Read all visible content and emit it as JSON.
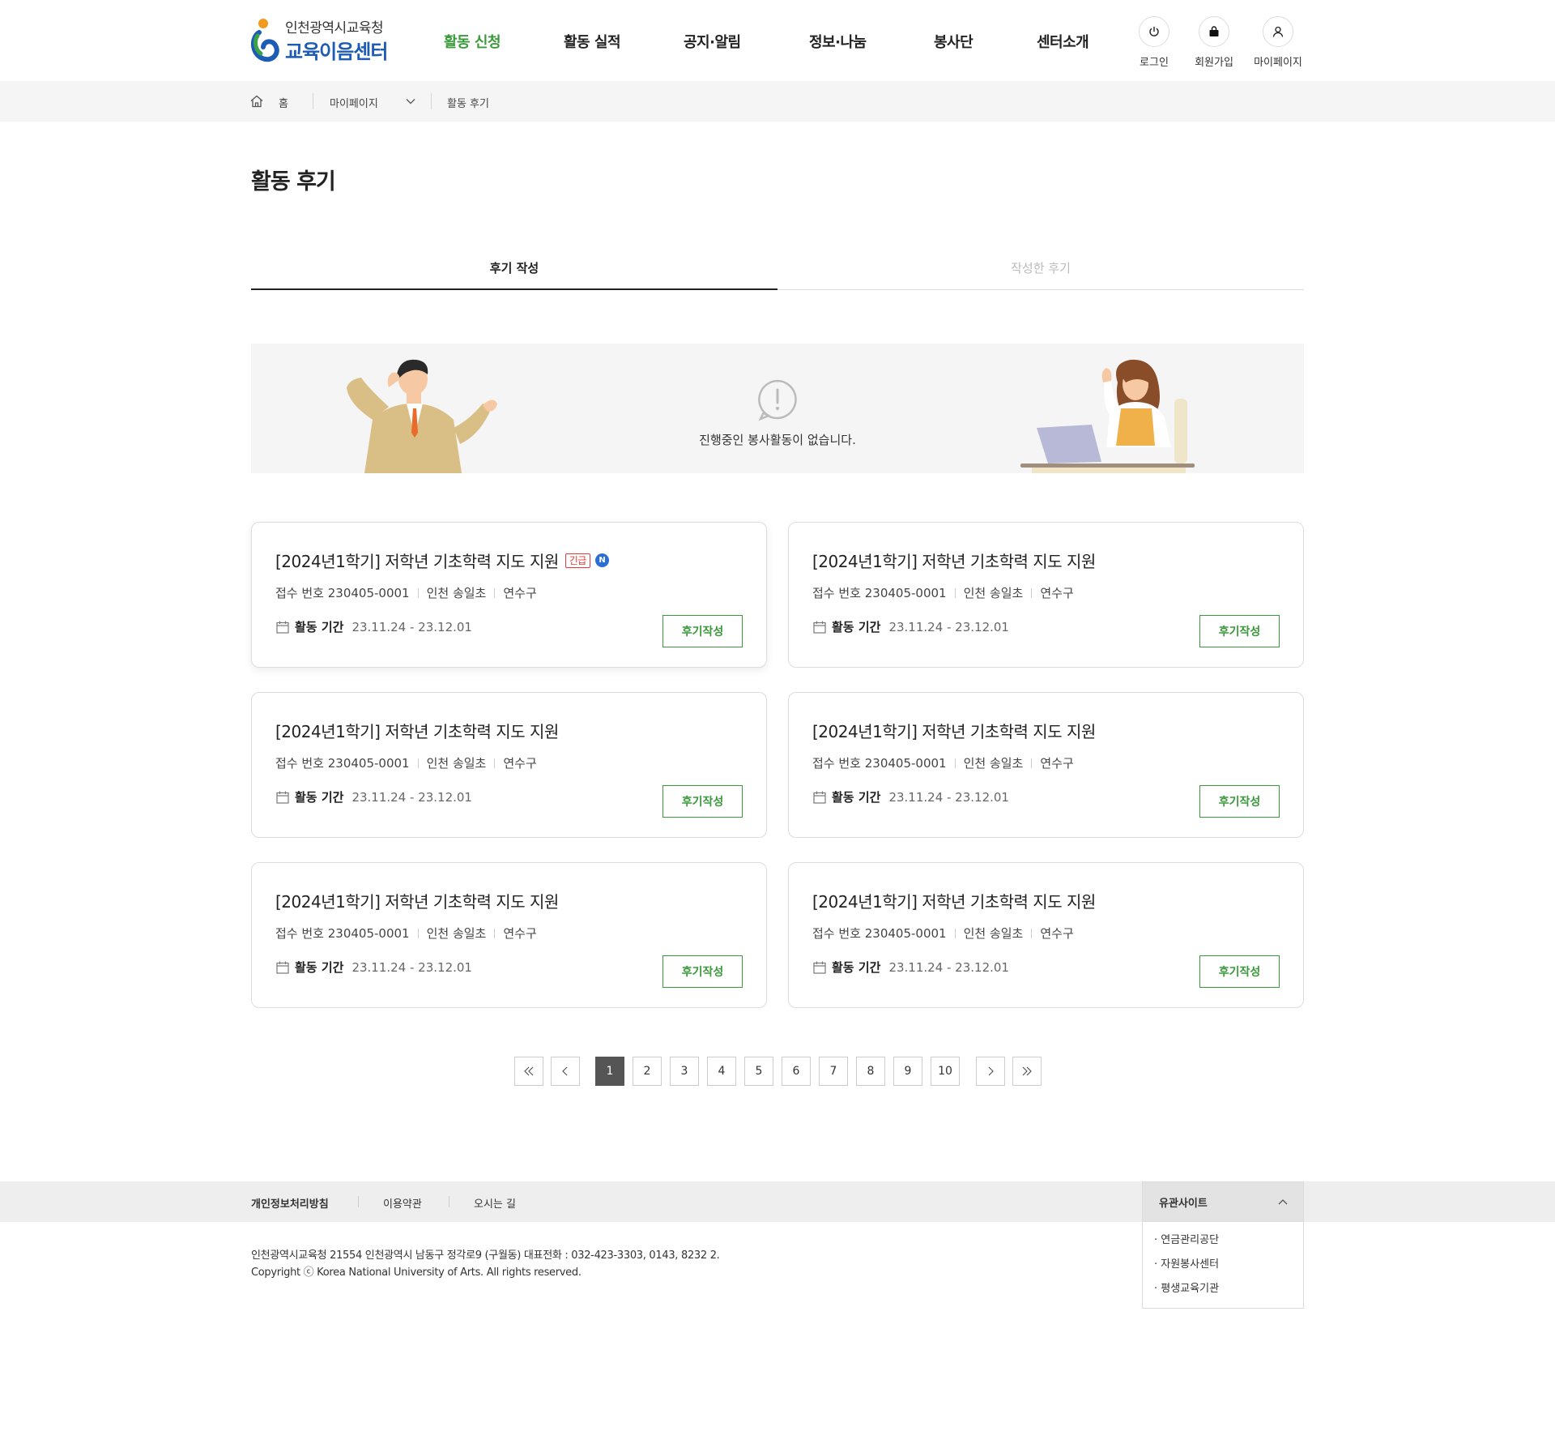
{
  "header": {
    "logo_top": "인천광역시교육청",
    "logo_bottom": "교육이음센터",
    "nav": [
      "활동 신청",
      "활동 실적",
      "공지·알림",
      "정보·나눔",
      "봉사단",
      "센터소개"
    ],
    "utils": [
      "로그인",
      "회원가입",
      "마이페이지"
    ]
  },
  "breadcrumb": {
    "home": "홈",
    "level1": "마이페이지",
    "level2": "활동 후기"
  },
  "page_title": "활동 후기",
  "tabs": {
    "write": "후기 작성",
    "written": "작성한 후기"
  },
  "banner": {
    "message": "진행중인 봉사활동이 없습니다."
  },
  "card_labels": {
    "period_label": "활동 기간",
    "button": "후기작성",
    "urgent_badge": "긴급",
    "new_badge": "N"
  },
  "cards": [
    {
      "title": "[2024년1학기] 저학년 기초학력 지도 지원",
      "receipt": "접수 번호 230405-0001",
      "school": "인천 송일초",
      "district": "연수구",
      "period": "23.11.24 - 23.12.01"
    },
    {
      "title": "[2024년1학기] 저학년 기초학력 지도 지원",
      "receipt": "접수 번호 230405-0001",
      "school": "인천 송일초",
      "district": "연수구",
      "period": "23.11.24 - 23.12.01"
    },
    {
      "title": "[2024년1학기] 저학년 기초학력 지도 지원",
      "receipt": "접수 번호 230405-0001",
      "school": "인천 송일초",
      "district": "연수구",
      "period": "23.11.24 - 23.12.01"
    },
    {
      "title": "[2024년1학기] 저학년 기초학력 지도 지원",
      "receipt": "접수 번호 230405-0001",
      "school": "인천 송일초",
      "district": "연수구",
      "period": "23.11.24 - 23.12.01"
    },
    {
      "title": "[2024년1학기] 저학년 기초학력 지도 지원",
      "receipt": "접수 번호 230405-0001",
      "school": "인천 송일초",
      "district": "연수구",
      "period": "23.11.24 - 23.12.01"
    },
    {
      "title": "[2024년1학기] 저학년 기초학력 지도 지원",
      "receipt": "접수 번호 230405-0001",
      "school": "인천 송일초",
      "district": "연수구",
      "period": "23.11.24 - 23.12.01"
    }
  ],
  "pagination": {
    "pages": [
      "1",
      "2",
      "3",
      "4",
      "5",
      "6",
      "7",
      "8",
      "9",
      "10"
    ],
    "current": "1"
  },
  "footer": {
    "links": [
      "개인정보처리방침",
      "이용약관",
      "오시는 길"
    ],
    "address": "인천광역시교육청 21554 인천광역시 남동구 정각로9 (구월동) 대표전화 : 032-423-3303, 0143, 8232 2.",
    "copyright": "Copyright ⓒ Korea National University of Arts. All rights reserved.",
    "family_title": "유관사이트",
    "family_sites": [
      "· 연금관리공단",
      "· 자원봉사센터",
      "· 평생교육기관"
    ]
  },
  "colors": {
    "accent_green": "#3a9a3a",
    "brand_blue": "#1e5bb5",
    "urgent_red": "#e53935",
    "new_blue": "#2b6fd6"
  }
}
